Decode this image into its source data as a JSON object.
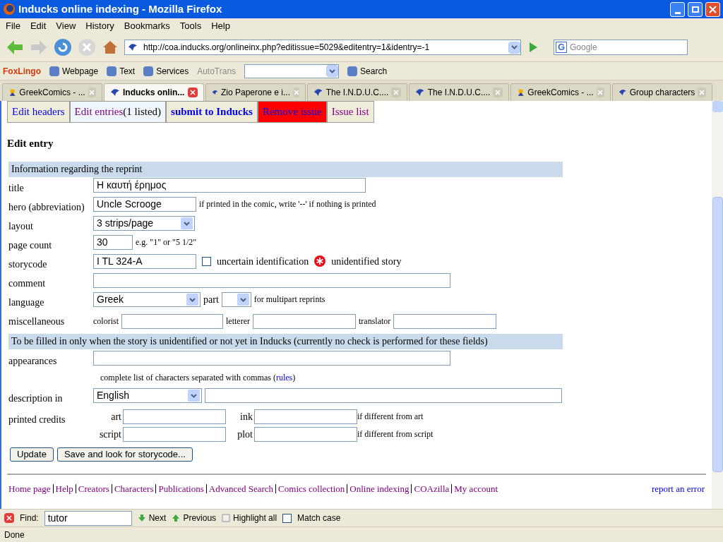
{
  "window": {
    "title": "Inducks online indexing - Mozilla Firefox"
  },
  "menu": [
    "File",
    "Edit",
    "View",
    "History",
    "Bookmarks",
    "Tools",
    "Help"
  ],
  "address": {
    "value": "http://coa.inducks.org/onlineinx.php?editissue=5029&editentry=1&identry=-1"
  },
  "search": {
    "placeholder": "Google",
    "engine": "G"
  },
  "toolbar2": [
    {
      "kind": "brand",
      "label": "FoxLingo"
    },
    {
      "kind": "menu",
      "label": "Webpage"
    },
    {
      "kind": "menu",
      "label": "Text"
    },
    {
      "kind": "menu",
      "label": "Services"
    },
    {
      "kind": "disabled",
      "label": "AutoTrans"
    },
    {
      "kind": "select"
    },
    {
      "kind": "menu",
      "label": "Search"
    }
  ],
  "tabs": [
    {
      "label": "GreekComics - ...",
      "kind": "duck",
      "selected": false
    },
    {
      "label": "Inducks onlin...",
      "kind": "site",
      "selected": true
    },
    {
      "label": "Zio Paperone e i...",
      "kind": "site",
      "selected": false
    },
    {
      "label": "The I.N.D.U.C....",
      "kind": "site",
      "selected": false
    },
    {
      "label": "The I.N.D.U.C....",
      "kind": "site",
      "selected": false
    },
    {
      "label": "GreekComics - ...",
      "kind": "duck",
      "selected": false
    },
    {
      "label": "Group characters",
      "kind": "site",
      "selected": false
    }
  ],
  "page_tabs": [
    {
      "label": "Edit headers",
      "kind": "link",
      "visited": false,
      "selected": false
    },
    {
      "label": "Edit entries",
      "extra": "(1 listed)",
      "kind": "link",
      "visited": true,
      "selected": true
    },
    {
      "label": "submit to Inducks",
      "kind": "bold",
      "visited": false,
      "selected": false
    },
    {
      "label": "Remove issue",
      "kind": "danger",
      "visited": false,
      "selected": false
    },
    {
      "label": "Issue list",
      "kind": "link",
      "visited": true,
      "selected": false
    }
  ],
  "heading": "Edit entry",
  "section1": {
    "title": "Information regarding the reprint",
    "rows": [
      {
        "kind": "text",
        "label": "title",
        "value": "Η καυτή έρημος"
      },
      {
        "kind": "text",
        "label": "hero (abbreviation)",
        "value": "Uncle Scrooge",
        "note": "if printed in the comic, write '--' if nothing is printed"
      },
      {
        "kind": "select",
        "label": "layout",
        "value": "3 strips/page"
      },
      {
        "kind": "text",
        "label": "page count",
        "value": "30",
        "note": "e.g. \"1\" or \"5 1/2\""
      },
      {
        "kind": "storycode",
        "label": "storycode",
        "value": "I TL  324-A",
        "checkbox": "uncertain identification",
        "checked": false,
        "marker": "unidentified story"
      },
      {
        "kind": "text",
        "label": "comment",
        "value": ""
      },
      {
        "kind": "language",
        "label": "language",
        "value": "Greek",
        "part_label": "part",
        "note": "for multipart reprints"
      },
      {
        "kind": "misc",
        "label": "miscellaneous",
        "fields": [
          "colorist",
          "letterer",
          "translator"
        ]
      }
    ]
  },
  "section2": {
    "title": "To be filled in only when the story is unidentified or not yet in Inducks (currently no check is performed for these fields)",
    "appearances": {
      "label": "appearances",
      "hint": "complete list of characters separated with commas (",
      "link": "rules",
      "hint_end": ")"
    },
    "description": {
      "label": "description in",
      "language": "English"
    },
    "credits": {
      "label": "printed credits",
      "rows": [
        {
          "a": "art",
          "b": "ink",
          "note": "if different from art"
        },
        {
          "a": "script",
          "b": "plot",
          "note": "if different from script"
        }
      ]
    }
  },
  "buttons": [
    "Update",
    "Save and look for storycode..."
  ],
  "footer_links": [
    "Home page",
    "Help",
    "Creators",
    "Characters",
    "Publications",
    "Advanced Search",
    "Comics collection",
    "Online indexing",
    "COAzilla",
    "My account"
  ],
  "report_link": "report an error",
  "find": {
    "label": "Find:",
    "value": "tutor",
    "next": "Next",
    "previous": "Previous",
    "highlight": "Highlight all",
    "match_case": "Match case",
    "match_case_checked": false
  },
  "status": "Done"
}
